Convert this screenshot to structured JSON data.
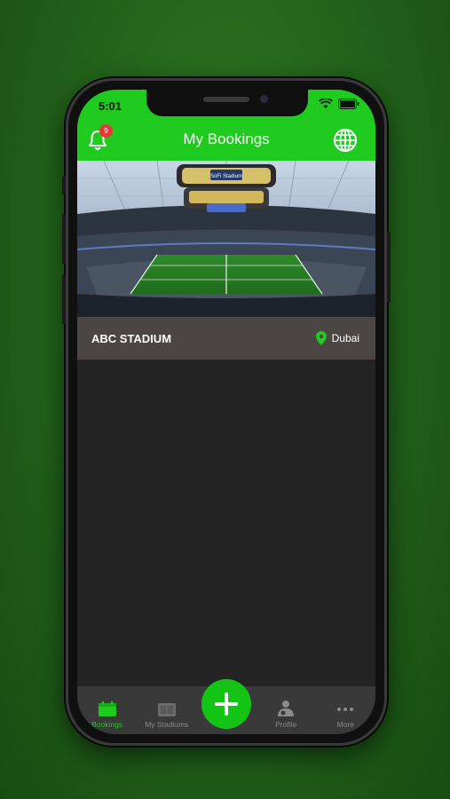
{
  "status_bar": {
    "time": "5:01"
  },
  "header": {
    "title": "My Bookings",
    "notification_count": "9"
  },
  "stadium": {
    "name": "ABC STADIUM",
    "location": "Dubai",
    "scoreboard_text": "SoFi Stadium"
  },
  "tabbar": {
    "items": [
      {
        "label": "Bookings",
        "icon": "calendar-icon"
      },
      {
        "label": "My Stadiums",
        "icon": "stadium-icon"
      },
      {
        "label": "",
        "icon": "add-icon"
      },
      {
        "label": "Profile",
        "icon": "profile-icon"
      },
      {
        "label": "More",
        "icon": "more-icon"
      }
    ]
  },
  "colors": {
    "accent": "#1ecb1e",
    "background": "#242424",
    "card_bar": "#4b4644",
    "badge": "#e53935"
  }
}
